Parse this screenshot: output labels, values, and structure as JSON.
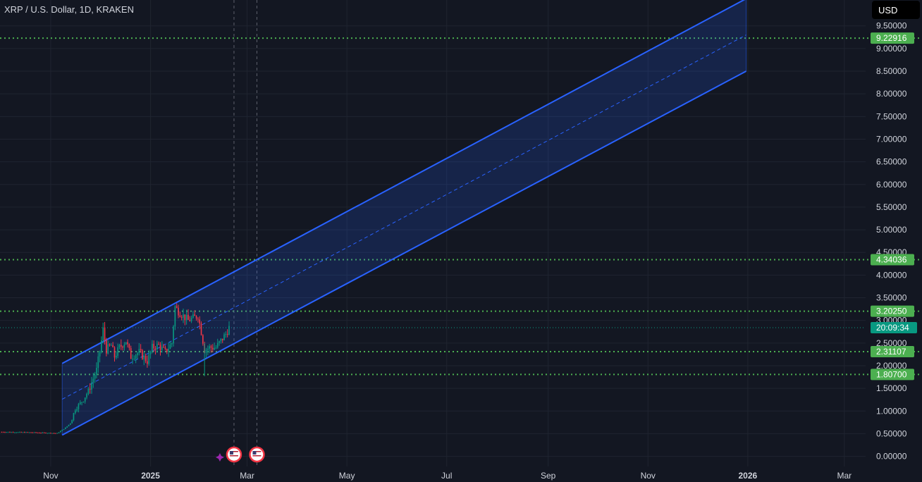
{
  "symbol_title": "XRP / U.S. Dollar, 1D, KRAKEN",
  "currency_button": "USD",
  "colors": {
    "background": "#131722",
    "grid": "#1f2430",
    "axis_text": "#d1d4dc",
    "channel_line": "#2962ff",
    "channel_fill": "rgba(41,98,255,0.18)",
    "level_line": "#4caf50",
    "level_label_bg": "#4caf50",
    "countdown_bg": "#089981",
    "candle_up": "#089981",
    "candle_down": "#f23645",
    "event_marker": "#f23645",
    "sparkle_marker": "#9c27b0"
  },
  "chart_data": {
    "type": "candlestick",
    "y_axis": {
      "range": [
        -0.1,
        9.9
      ],
      "ticks": [
        "0.00000",
        "0.50000",
        "1.00000",
        "1.50000",
        "2.00000",
        "2.50000",
        "3.00000",
        "3.50000",
        "4.00000",
        "4.50000",
        "5.00000",
        "5.50000",
        "6.00000",
        "6.50000",
        "7.00000",
        "7.50000",
        "8.00000",
        "8.50000",
        "9.00000",
        "9.50000"
      ]
    },
    "x_axis": {
      "range": [
        "2024-10-01",
        "2026-03-14"
      ],
      "ticks": [
        {
          "date": "2024-11-01",
          "label": "Nov"
        },
        {
          "date": "2025-01-01",
          "label": "2025"
        },
        {
          "date": "2025-03-01",
          "label": "Mar"
        },
        {
          "date": "2025-05-01",
          "label": "May"
        },
        {
          "date": "2025-07-01",
          "label": "Jul"
        },
        {
          "date": "2025-09-01",
          "label": "Sep"
        },
        {
          "date": "2025-11-01",
          "label": "Nov"
        },
        {
          "date": "2026-01-01",
          "label": "2026"
        },
        {
          "date": "2026-03-01",
          "label": "Mar"
        }
      ]
    },
    "horizontal_levels": [
      {
        "value": 9.22916,
        "label": "9.22916"
      },
      {
        "value": 4.34036,
        "label": "4.34036"
      },
      {
        "value": 3.2025,
        "label": "3.20250"
      },
      {
        "value": 2.31107,
        "label": "2.31107"
      },
      {
        "value": 1.807,
        "label": "1.80700"
      }
    ],
    "current_price": {
      "value": 2.84,
      "countdown": "20:09:34"
    },
    "regression_channel": {
      "start_date": "2024-11-08",
      "end_date": "2025-12-31",
      "upper": [
        2.05,
        10.1
      ],
      "center": [
        1.26,
        9.3
      ],
      "lower": [
        0.47,
        8.5
      ]
    },
    "event_markers": [
      "2025-02-21",
      "2025-03-07"
    ],
    "vertical_dashed_lines": [
      "2025-02-21",
      "2025-03-07"
    ],
    "price_path": [
      {
        "date": "2024-10-01",
        "close": 0.54
      },
      {
        "date": "2024-10-20",
        "close": 0.53
      },
      {
        "date": "2024-11-05",
        "close": 0.51
      },
      {
        "date": "2024-11-10",
        "close": 0.63
      },
      {
        "date": "2024-11-13",
        "close": 0.73
      },
      {
        "date": "2024-11-16",
        "close": 1.05
      },
      {
        "date": "2024-11-21",
        "close": 1.25
      },
      {
        "date": "2024-11-24",
        "close": 1.45
      },
      {
        "date": "2024-11-29",
        "close": 1.9
      },
      {
        "date": "2024-12-02",
        "close": 2.55
      },
      {
        "date": "2024-12-03",
        "close": 2.8
      },
      {
        "date": "2024-12-05",
        "close": 2.35
      },
      {
        "date": "2024-12-08",
        "close": 2.45
      },
      {
        "date": "2024-12-10",
        "close": 2.2
      },
      {
        "date": "2024-12-13",
        "close": 2.4
      },
      {
        "date": "2024-12-17",
        "close": 2.55
      },
      {
        "date": "2024-12-20",
        "close": 2.2
      },
      {
        "date": "2024-12-25",
        "close": 2.3
      },
      {
        "date": "2024-12-30",
        "close": 2.1
      },
      {
        "date": "2025-01-02",
        "close": 2.4
      },
      {
        "date": "2025-01-06",
        "close": 2.45
      },
      {
        "date": "2025-01-10",
        "close": 2.3
      },
      {
        "date": "2025-01-14",
        "close": 2.5
      },
      {
        "date": "2025-01-16",
        "close": 3.3
      },
      {
        "date": "2025-01-18",
        "close": 3.2
      },
      {
        "date": "2025-01-21",
        "close": 3.1
      },
      {
        "date": "2025-01-24",
        "close": 3.0
      },
      {
        "date": "2025-01-27",
        "close": 3.05
      },
      {
        "date": "2025-01-30",
        "close": 3.1
      },
      {
        "date": "2025-02-01",
        "close": 2.75
      },
      {
        "date": "2025-02-03",
        "close": 2.35
      },
      {
        "date": "2025-02-06",
        "close": 2.4
      },
      {
        "date": "2025-02-10",
        "close": 2.4
      },
      {
        "date": "2025-02-13",
        "close": 2.55
      },
      {
        "date": "2025-02-16",
        "close": 2.7
      },
      {
        "date": "2025-02-18",
        "close": 2.84
      }
    ]
  }
}
